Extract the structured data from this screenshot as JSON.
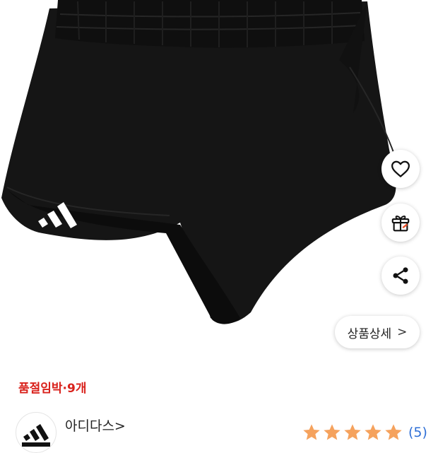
{
  "product": {
    "image_description": "black shorts",
    "rating_value": 5
  },
  "actions": {
    "heart_icon": "heart-outline-icon",
    "gift_icon": "gift-icon",
    "share_icon": "share-icon",
    "detail_label": "상품상세",
    "detail_chevron": ">"
  },
  "stock": {
    "text": "품절임박·9개"
  },
  "brand": {
    "name": "아디다스>"
  },
  "review": {
    "count_text": "(5)"
  },
  "colors": {
    "stock_red": "#d9221c",
    "star_orange": "#f5a25d",
    "count_blue": "#2f6fd6",
    "text_dark": "#222222"
  }
}
